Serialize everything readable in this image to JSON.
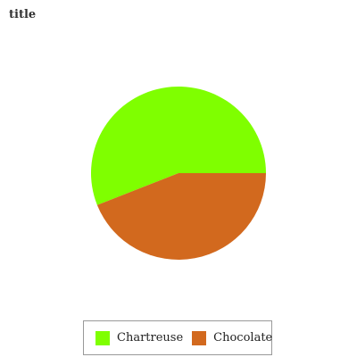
{
  "chart_data": {
    "type": "pie",
    "title": "title",
    "categories": [
      "Chartreuse",
      "Chocolate"
    ],
    "values": [
      56,
      44
    ],
    "colors": [
      "#7fff00",
      "#d2691e"
    ],
    "legend_position": "bottom"
  }
}
